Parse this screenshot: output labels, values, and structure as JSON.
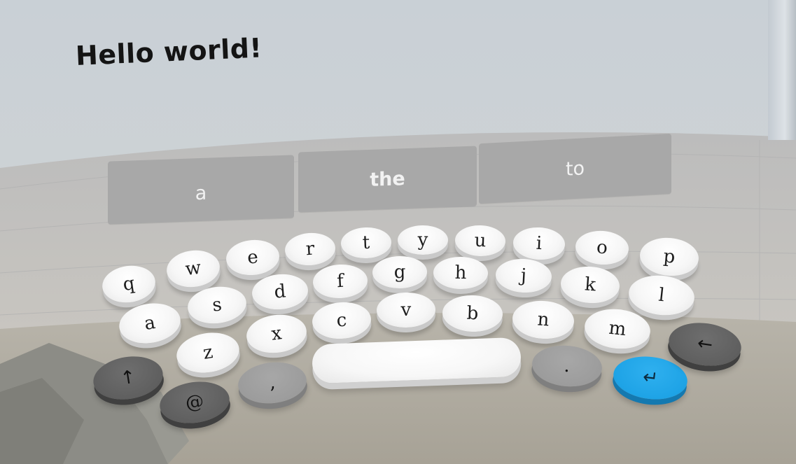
{
  "input": {
    "text": "Hello world!"
  },
  "suggestions": [
    "a",
    "the",
    "to"
  ],
  "keyboard": {
    "rows": [
      [
        "q",
        "w",
        "e",
        "r",
        "t",
        "y",
        "u",
        "i",
        "o",
        "p"
      ],
      [
        "a",
        "s",
        "d",
        "f",
        "g",
        "h",
        "j",
        "k",
        "l"
      ],
      [
        "z",
        "x",
        "c",
        "v",
        "b",
        "n",
        "m"
      ]
    ],
    "comma": ",",
    "period": ".",
    "at": "@",
    "shift_icon": "shift-arrow-icon",
    "backspace_icon": "backspace-arrow-icon",
    "enter_icon": "enter-return-icon"
  },
  "colors": {
    "enter_key": "#1ea3e6",
    "dark_keys": "#5f5f5f",
    "gray_keys": "#9c9c9c"
  }
}
